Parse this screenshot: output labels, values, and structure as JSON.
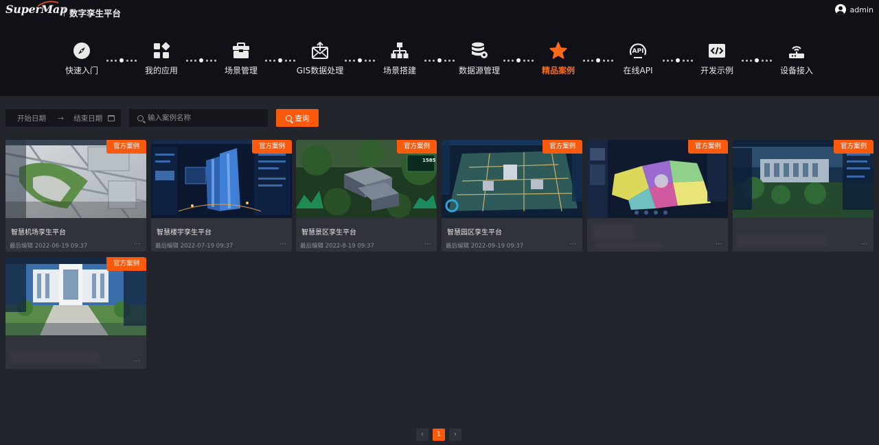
{
  "header": {
    "logo_text": "SuperMap",
    "app_title": "数字孪生平台",
    "user_name": "admin"
  },
  "nav": {
    "active_index": 6,
    "accent_color": "#ff6a1a",
    "items": [
      {
        "label": "快速入门",
        "icon": "compass-icon"
      },
      {
        "label": "我的应用",
        "icon": "apps-grid-icon"
      },
      {
        "label": "场景管理",
        "icon": "toolbox-icon"
      },
      {
        "label": "GIS数据处理",
        "icon": "data-process-icon"
      },
      {
        "label": "场景搭建",
        "icon": "hierarchy-icon"
      },
      {
        "label": "数据源管理",
        "icon": "database-gear-icon"
      },
      {
        "label": "精品案例",
        "icon": "star-icon"
      },
      {
        "label": "在线API",
        "icon": "api-icon"
      },
      {
        "label": "开发示例",
        "icon": "code-window-icon"
      },
      {
        "label": "设备接入",
        "icon": "router-icon"
      }
    ]
  },
  "filters": {
    "start_placeholder": "开始日期",
    "end_placeholder": "结束日期",
    "search_placeholder": "输入案例名称",
    "query_label": "查询"
  },
  "cards": [
    {
      "badge": "官方案例",
      "title": "智慧机场孪生平台",
      "meta": "最后编辑 2022-06-19 09:37",
      "more": "...",
      "thumb": "airport-thumbnail"
    },
    {
      "badge": "官方案例",
      "title": "智慧楼宇孪生平台",
      "meta": "最后编辑 2022-07-19 09:37",
      "more": "...",
      "thumb": "building-thumbnail"
    },
    {
      "badge": "官方案例",
      "title": "智慧景区孪生平台",
      "meta": "最后编辑 2022-8-19 09:37",
      "more": "...",
      "thumb": "scenic-thumbnail"
    },
    {
      "badge": "官方案例",
      "title": "智慧园区孪生平台",
      "meta": "最后编辑 2022-09-19 09:37",
      "more": "...",
      "thumb": "park-thumbnail"
    },
    {
      "badge": "官方案例",
      "title": "",
      "meta": "",
      "more": "...",
      "thumb": "map-zones-thumbnail"
    },
    {
      "badge": "官方案例",
      "title": "",
      "meta": "",
      "more": "...",
      "thumb": "campus-thumbnail"
    },
    {
      "badge": "官方案例",
      "title": "",
      "meta": "",
      "more": "...",
      "thumb": "government-building-thumbnail"
    }
  ],
  "pagination": {
    "prev": "‹",
    "current": "1",
    "next": "›"
  }
}
